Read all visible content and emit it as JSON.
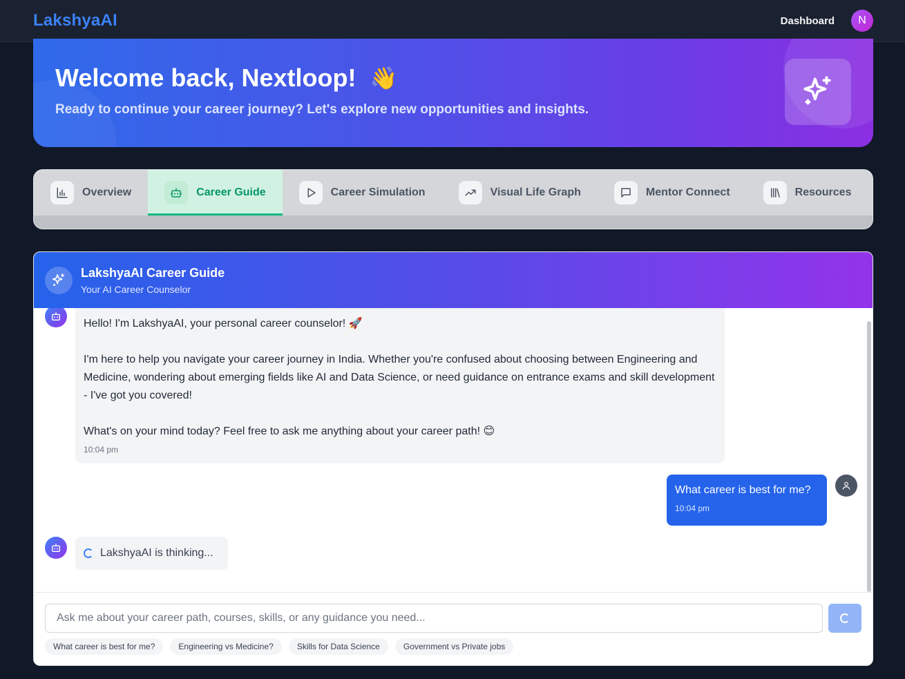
{
  "app": {
    "logo": "LakshyaAI"
  },
  "nav": {
    "dashboard_label": "Dashboard",
    "avatar_initial": "N"
  },
  "hero": {
    "title": "Welcome back, Nextloop!",
    "emoji": "👋",
    "subtitle": "Ready to continue your career journey? Let's explore new opportunities and insights.",
    "icon": "sparkles-icon"
  },
  "tabs": [
    {
      "label": "Overview",
      "icon": "bar-chart-icon",
      "active": false
    },
    {
      "label": "Career Guide",
      "icon": "bot-icon",
      "active": true
    },
    {
      "label": "Career Simulation",
      "icon": "play-icon",
      "active": false
    },
    {
      "label": "Visual Life Graph",
      "icon": "trending-up-icon",
      "active": false
    },
    {
      "label": "Mentor Connect",
      "icon": "message-square-icon",
      "active": false
    },
    {
      "label": "Resources",
      "icon": "library-icon",
      "active": false
    }
  ],
  "chat": {
    "title": "LakshyaAI Career Guide",
    "subtitle": "Your AI Career Counselor",
    "messages": [
      {
        "role": "bot",
        "lines": [
          "Hello! I'm LakshyaAI, your personal career counselor! 🚀",
          "I'm here to help you navigate your career journey in India. Whether you're confused about choosing between Engineering and Medicine, wondering about emerging fields like AI and Data Science, or need guidance on entrance exams and skill development - I've got you covered!",
          "What's on your mind today? Feel free to ask me anything about your career path! 😊"
        ],
        "time": "10:04 pm"
      },
      {
        "role": "user",
        "text": "What career is best for me?",
        "time": "10:04 pm"
      }
    ],
    "thinking_text": "LakshyaAI is thinking...",
    "input_placeholder": "Ask me about your career path, courses, skills, or any guidance you need...",
    "suggestions": [
      "What career is best for me?",
      "Engineering vs Medicine?",
      "Skills for Data Science",
      "Government vs Private jobs"
    ]
  },
  "colors": {
    "primary": "#2563eb",
    "accent_purple": "#9333ea",
    "active_tab": "#059669",
    "page_bg": "#111827"
  }
}
